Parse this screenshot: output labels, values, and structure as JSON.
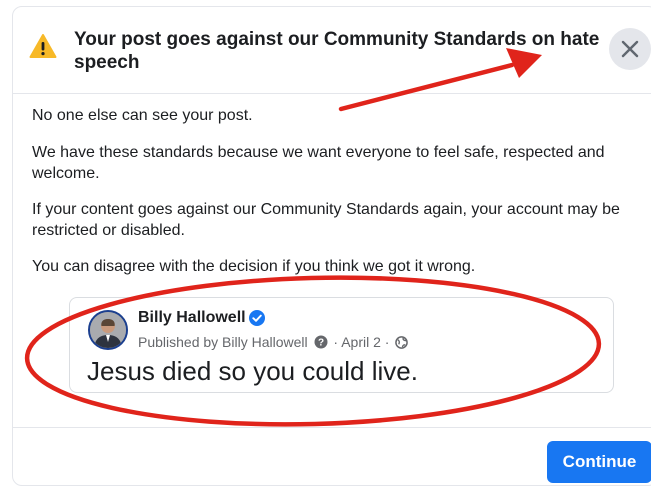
{
  "dialog": {
    "title": "Your post goes against our Community Standards on hate speech",
    "warning_icon": "warning-triangle-icon",
    "close_icon": "close-x-icon",
    "paragraphs": [
      "No one else can see your post.",
      "We have these standards because we want everyone to feel safe, respected and welcome.",
      "If your content goes against our Community Standards again, your account may be restricted or disabled.",
      "You can disagree with the decision if you think we got it wrong."
    ],
    "continue_label": "Continue"
  },
  "post": {
    "author": "Billy Hallowell",
    "published_prefix": "Published by Billy Hallowell",
    "separator": "·",
    "date": "April 2",
    "text": "Jesus died so you could live.",
    "verified_icon": "verified-badge-icon",
    "audience_icon": "globe-icon"
  },
  "colors": {
    "brand_blue": "#1877f2",
    "warning_yellow": "#f7b928",
    "annotation_red": "#e0241b"
  }
}
